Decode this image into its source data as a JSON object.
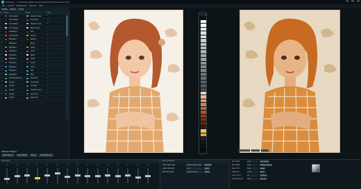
{
  "window": {
    "title": "PixelForge - C:\\Users\\Projects\\Paint-by-Number\\PixelForge\\workbench.pfm"
  },
  "menu": [
    "File",
    "Layout",
    "Preferences",
    "Window",
    "Help"
  ],
  "toolbar": [
    "Palette",
    "Regions",
    "Colors"
  ],
  "palette": {
    "headers": [
      "#",
      "Name",
      "Name",
      "Hex"
    ],
    "rows": [
      {
        "n": "1",
        "c1": "#4a6d48",
        "name1": "Chromatest",
        "c2": "#7aa0b8",
        "name2": "Serpent Green",
        "val": "4"
      },
      {
        "n": "2",
        "c1": "#2d2e30",
        "name1": "Chromatest",
        "c2": "#5e5e5e",
        "name2": "Gunmetal",
        "val": "12"
      },
      {
        "n": "3",
        "c1": "#c7c6c4",
        "name1": "Chromatest",
        "c2": "#a6a8a6",
        "name2": "Shimmer Grey",
        "val": "4"
      },
      {
        "n": "4",
        "c1": "#d8d8d8",
        "name1": "Chromatest",
        "c2": "#d3d2d0",
        "name2": "Mauve Grey",
        "val": "6"
      },
      {
        "n": "5",
        "c1": "#8b2a2a",
        "name1": "SaltDesign",
        "c2": "#6b3c3c",
        "name2": "Clay",
        "val": "9"
      },
      {
        "n": "6",
        "c1": "#c75b39",
        "name1": "Chromatest",
        "c2": "#de8f5d",
        "name2": "Sunset",
        "val": "8"
      },
      {
        "n": "7",
        "c1": "#7f4f2c",
        "name1": "Wilgreens",
        "c2": "#6b4a2a",
        "name2": "Walnut",
        "val": "2"
      },
      {
        "n": "8",
        "c1": "#242424",
        "name1": "Wilgreens",
        "c2": "#181818",
        "name2": "Black",
        "val": "4"
      },
      {
        "n": "9",
        "c1": "#4aa24a",
        "name1": "Wilgreens",
        "c2": "#59b359",
        "name2": "Green",
        "val": "3"
      },
      {
        "n": "10",
        "c1": "#dc4b3f",
        "name1": "Wilgreens",
        "c2": "#c94035",
        "name2": "Coral",
        "val": "1"
      },
      {
        "n": "11",
        "c1": "#e0e0e0",
        "name1": "Wilgreens",
        "c2": "#efefef",
        "name2": "White",
        "val": "6"
      },
      {
        "n": "12",
        "c1": "#d4a74b",
        "name1": "Wilgreens",
        "c2": "#c79b46",
        "name2": "Ochre",
        "val": "3"
      },
      {
        "n": "13",
        "c1": "#7d3b8c",
        "name1": "Wilgreens",
        "c2": "#6c357d",
        "name2": "Violet",
        "val": "5"
      },
      {
        "n": "14",
        "c1": "#3d8bd6",
        "name1": "Wilgreens",
        "c2": "#4a9ee3",
        "name2": "Azure",
        "val": "6"
      },
      {
        "n": "15",
        "c1": "#2aa6a1",
        "name1": "Wilgreens",
        "c2": "#2fb7ae",
        "name2": "Teal",
        "val": "2"
      },
      {
        "n": "16",
        "c1": "#6ec1e8",
        "name1": "Wilgreens",
        "c2": "#5aa8d6",
        "name2": "Blue",
        "val": "4"
      },
      {
        "n": "17",
        "c1": "#4f9a55",
        "name1": "Wunderpalett (A)",
        "c2": "#6aa86b",
        "name2": "Pine Leaf",
        "val": "7"
      },
      {
        "n": "18",
        "c1": "#b8c85e",
        "name1": "Cryptic",
        "c2": "#aabd52",
        "name2": "Chartreuse",
        "val": "2"
      },
      {
        "n": "19",
        "c1": "#3aa0c8",
        "name1": "Cryptic",
        "c2": "#2e8fb5",
        "name2": "Cerulean",
        "val": "4"
      },
      {
        "n": "20",
        "c1": "#8a5a3c",
        "name1": "Cryptic",
        "c2": "#9b6a48",
        "name2": "Oil Brown Red",
        "val": "7"
      },
      {
        "n": "21",
        "c1": "#5b5b5b",
        "name1": "Cryptic",
        "c2": "#6e6e6e",
        "name2": "Lead Grey",
        "val": "3"
      },
      {
        "n": "22",
        "c1": "#c99bd9",
        "name1": "Cryptic",
        "c2": "#b98ccb",
        "name2": "Rose Lilac",
        "val": "2"
      }
    ],
    "footer": [
      "Reset Mixture",
      "Save Palette",
      "Export",
      "Add Palette Set"
    ],
    "status": "Selected: *Region*"
  },
  "gradient": {
    "label": "Color Map",
    "cells": [
      "#ffffff",
      "#f7f7f7",
      "#ededed",
      "#e3e3e3",
      "#d9d9d9",
      "#cfcfcf",
      "#c5c5c5",
      "#bbbbbb",
      "#b1b1b1",
      "#a7a7a7",
      "#9d9d9d",
      "#939393",
      "#898989",
      "#7f7f7f",
      "#757575",
      "#6b6b6b",
      "#616161",
      "#575757",
      "#4d4d4d",
      "#f1d2b4",
      "#e8b890",
      "#de9e6d",
      "#d4844a",
      "#c46a36",
      "#b05026",
      "#9a3c1e",
      "#7e2e18",
      "#5f2413",
      "#3f190c",
      "#f2c94c",
      "#e3a93a",
      "#1f1f1f",
      "#161616",
      "#101010",
      "#0a0a0a"
    ]
  },
  "right_bar": [
    "Show Original",
    "100.00%",
    "Zoom Fit"
  ],
  "mixer": {
    "title": "Color Mixer",
    "sliders": [
      {
        "label": "0.4",
        "level": 0.35
      },
      {
        "label": "0.2",
        "level": 0.55
      },
      {
        "label": "0.5",
        "level": 0.6
      },
      {
        "label": "0.3",
        "level": 0.4
      },
      {
        "label": "0.5",
        "level": 0.6
      },
      {
        "label": "0.8",
        "level": 0.75
      },
      {
        "label": "0.5",
        "level": 0.5
      },
      {
        "label": "0.5",
        "level": 0.6
      },
      {
        "label": "0.3",
        "level": 0.55
      },
      {
        "label": "0.5",
        "level": 0.55
      },
      {
        "label": "0.4",
        "level": 0.6
      },
      {
        "label": "0.2",
        "level": 0.55
      },
      {
        "label": "0.5",
        "level": 0.6
      },
      {
        "label": "0.5",
        "level": 0.45
      },
      {
        "label": "0.5",
        "level": 0.55
      }
    ]
  },
  "lighting": {
    "title": "Lighting Settings",
    "rows": [
      {
        "k": "HDR Light Type",
        "v": "Natural White Light",
        "b": "Preset B"
      },
      {
        "k": "Light Intensity",
        "v": "1.00",
        "b": "Apply"
      },
      {
        "k": "Blending Type",
        "v": "Natural Mixing",
        "b": "Match"
      }
    ]
  },
  "props": {
    "rows": [
      {
        "k": "Min Depth",
        "v": "0.25",
        "btn": "Use Image"
      },
      {
        "k": "Max Depth",
        "v": "1.00",
        "btn": "Offset Lighting"
      },
      {
        "k": "Paper Tint",
        "v": "0.00",
        "btn": "Reset"
      },
      {
        "k": "Saturation",
        "v": "1.00",
        "btn": "Clear"
      },
      {
        "k": "Color Count",
        "v": "30",
        "btn": "Lighting"
      },
      {
        "k": "Edge Removal",
        "v": "0.00",
        "btn": "Smooth"
      }
    ]
  }
}
